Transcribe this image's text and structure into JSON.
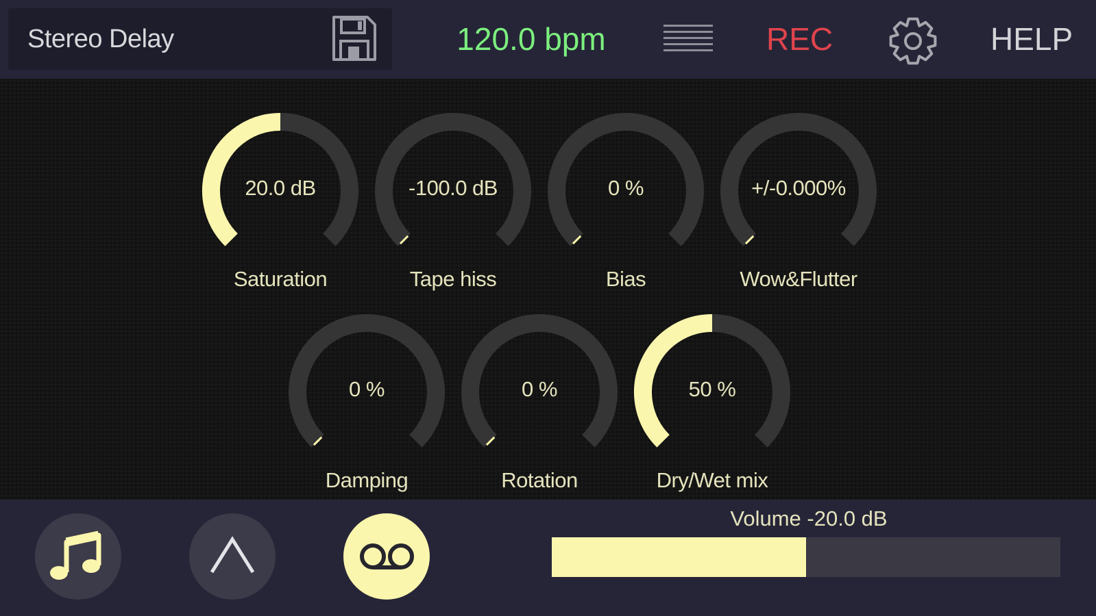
{
  "topbar": {
    "preset_name": "Stereo Delay",
    "save_icon": "floppy-disk-icon",
    "tempo": "120.0 bpm",
    "menu_icon": "hamburger-menu-icon",
    "rec_label": "REC",
    "settings_icon": "gear-icon",
    "help_label": "HELP"
  },
  "colors": {
    "accent": "#fbf6ad",
    "tempo": "#7cf07e",
    "rec": "#e0444c",
    "knob_track": "#353535",
    "bar_bg": "#262538"
  },
  "knobs": [
    {
      "label": "Saturation",
      "value_text": "20.0 dB",
      "level": 0.5
    },
    {
      "label": "Tape hiss",
      "value_text": "-100.0 dB",
      "level": 0
    },
    {
      "label": "Bias",
      "value_text": "0 %",
      "level": 0
    },
    {
      "label": "Wow&Flutter",
      "value_text": "+/-0.000%",
      "level": 0
    },
    {
      "label": "Damping",
      "value_text": "0 %",
      "level": 0
    },
    {
      "label": "Rotation",
      "value_text": "0 %",
      "level": 0
    },
    {
      "label": "Dry/Wet mix",
      "value_text": "50 %",
      "level": 0.5
    }
  ],
  "bottombar": {
    "buttons": [
      {
        "icon": "music-note-icon",
        "active": false
      },
      {
        "icon": "caret-up-icon",
        "active": false
      },
      {
        "icon": "tape-reel-icon",
        "active": true
      }
    ],
    "volume_label": "Volume -20.0 dB",
    "volume_level": 0.5
  }
}
